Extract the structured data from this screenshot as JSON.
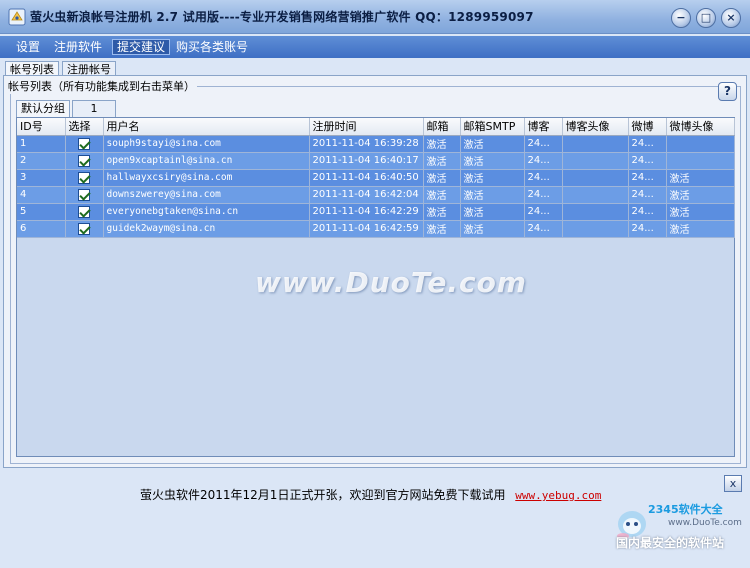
{
  "window": {
    "title": "萤火虫新浪帐号注册机 2.7 试用版----专业开发销售网络营销推广软件 QQ：1289959097"
  },
  "menu": {
    "items": [
      "设置",
      "注册软件",
      "提交建议",
      "购买各类账号"
    ],
    "active": "提交建议"
  },
  "tabs": {
    "items": [
      "帐号列表",
      "注册帐号"
    ],
    "selected": "帐号列表"
  },
  "group": {
    "label": "帐号列表（所有功能集成到右击菜单）",
    "help": "?"
  },
  "subtabs": {
    "items": [
      "默认分组",
      "1"
    ]
  },
  "table": {
    "headers": [
      "ID号",
      "选择",
      "用户名",
      "注册时间",
      "邮箱",
      "邮箱SMTP",
      "博客",
      "博客头像",
      "微博",
      "微博头像"
    ],
    "rows": [
      {
        "id": "1",
        "checked": true,
        "username": "souph9stayi@sina.com",
        "time": "2011-11-04 16:39:28",
        "mail": "激活",
        "smtp": "激活",
        "blog": "24...",
        "blog_avatar": "",
        "weibo": "24...",
        "weibo_avatar": ""
      },
      {
        "id": "2",
        "checked": true,
        "username": "open9xcaptainl@sina.cn",
        "time": "2011-11-04 16:40:17",
        "mail": "激活",
        "smtp": "激活",
        "blog": "24...",
        "blog_avatar": "",
        "weibo": "24...",
        "weibo_avatar": ""
      },
      {
        "id": "3",
        "checked": true,
        "username": "hallwayxcsiry@sina.com",
        "time": "2011-11-04 16:40:50",
        "mail": "激活",
        "smtp": "激活",
        "blog": "24...",
        "blog_avatar": "",
        "weibo": "24...",
        "weibo_avatar": "激活"
      },
      {
        "id": "4",
        "checked": true,
        "username": "downszwerey@sina.com",
        "time": "2011-11-04 16:42:04",
        "mail": "激活",
        "smtp": "激活",
        "blog": "24...",
        "blog_avatar": "",
        "weibo": "24...",
        "weibo_avatar": "激活"
      },
      {
        "id": "5",
        "checked": true,
        "username": "everyonebgtaken@sina.cn",
        "time": "2011-11-04 16:42:29",
        "mail": "激活",
        "smtp": "激活",
        "blog": "24...",
        "blog_avatar": "",
        "weibo": "24...",
        "weibo_avatar": "激活"
      },
      {
        "id": "6",
        "checked": true,
        "username": "guidek2waym@sina.cn",
        "time": "2011-11-04 16:42:59",
        "mail": "激活",
        "smtp": "激活",
        "blog": "24...",
        "blog_avatar": "",
        "weibo": "24...",
        "weibo_avatar": "激活"
      }
    ]
  },
  "footer": {
    "text": "萤火虫软件2011年12月1日正式开张，欢迎到官方网站免费下载试用",
    "link": "www.yebug.com",
    "close": "x"
  },
  "watermark": {
    "center": "www.DuoTe.com",
    "corner_brand": "2345软件大全",
    "corner_site": "www.DuoTe.com",
    "corner_slogan": "国内最安全的软件站"
  },
  "colors": {
    "menu_bg": "#3e6fc4",
    "row_bg": "#5b8ee0",
    "link": "#cc0000"
  }
}
